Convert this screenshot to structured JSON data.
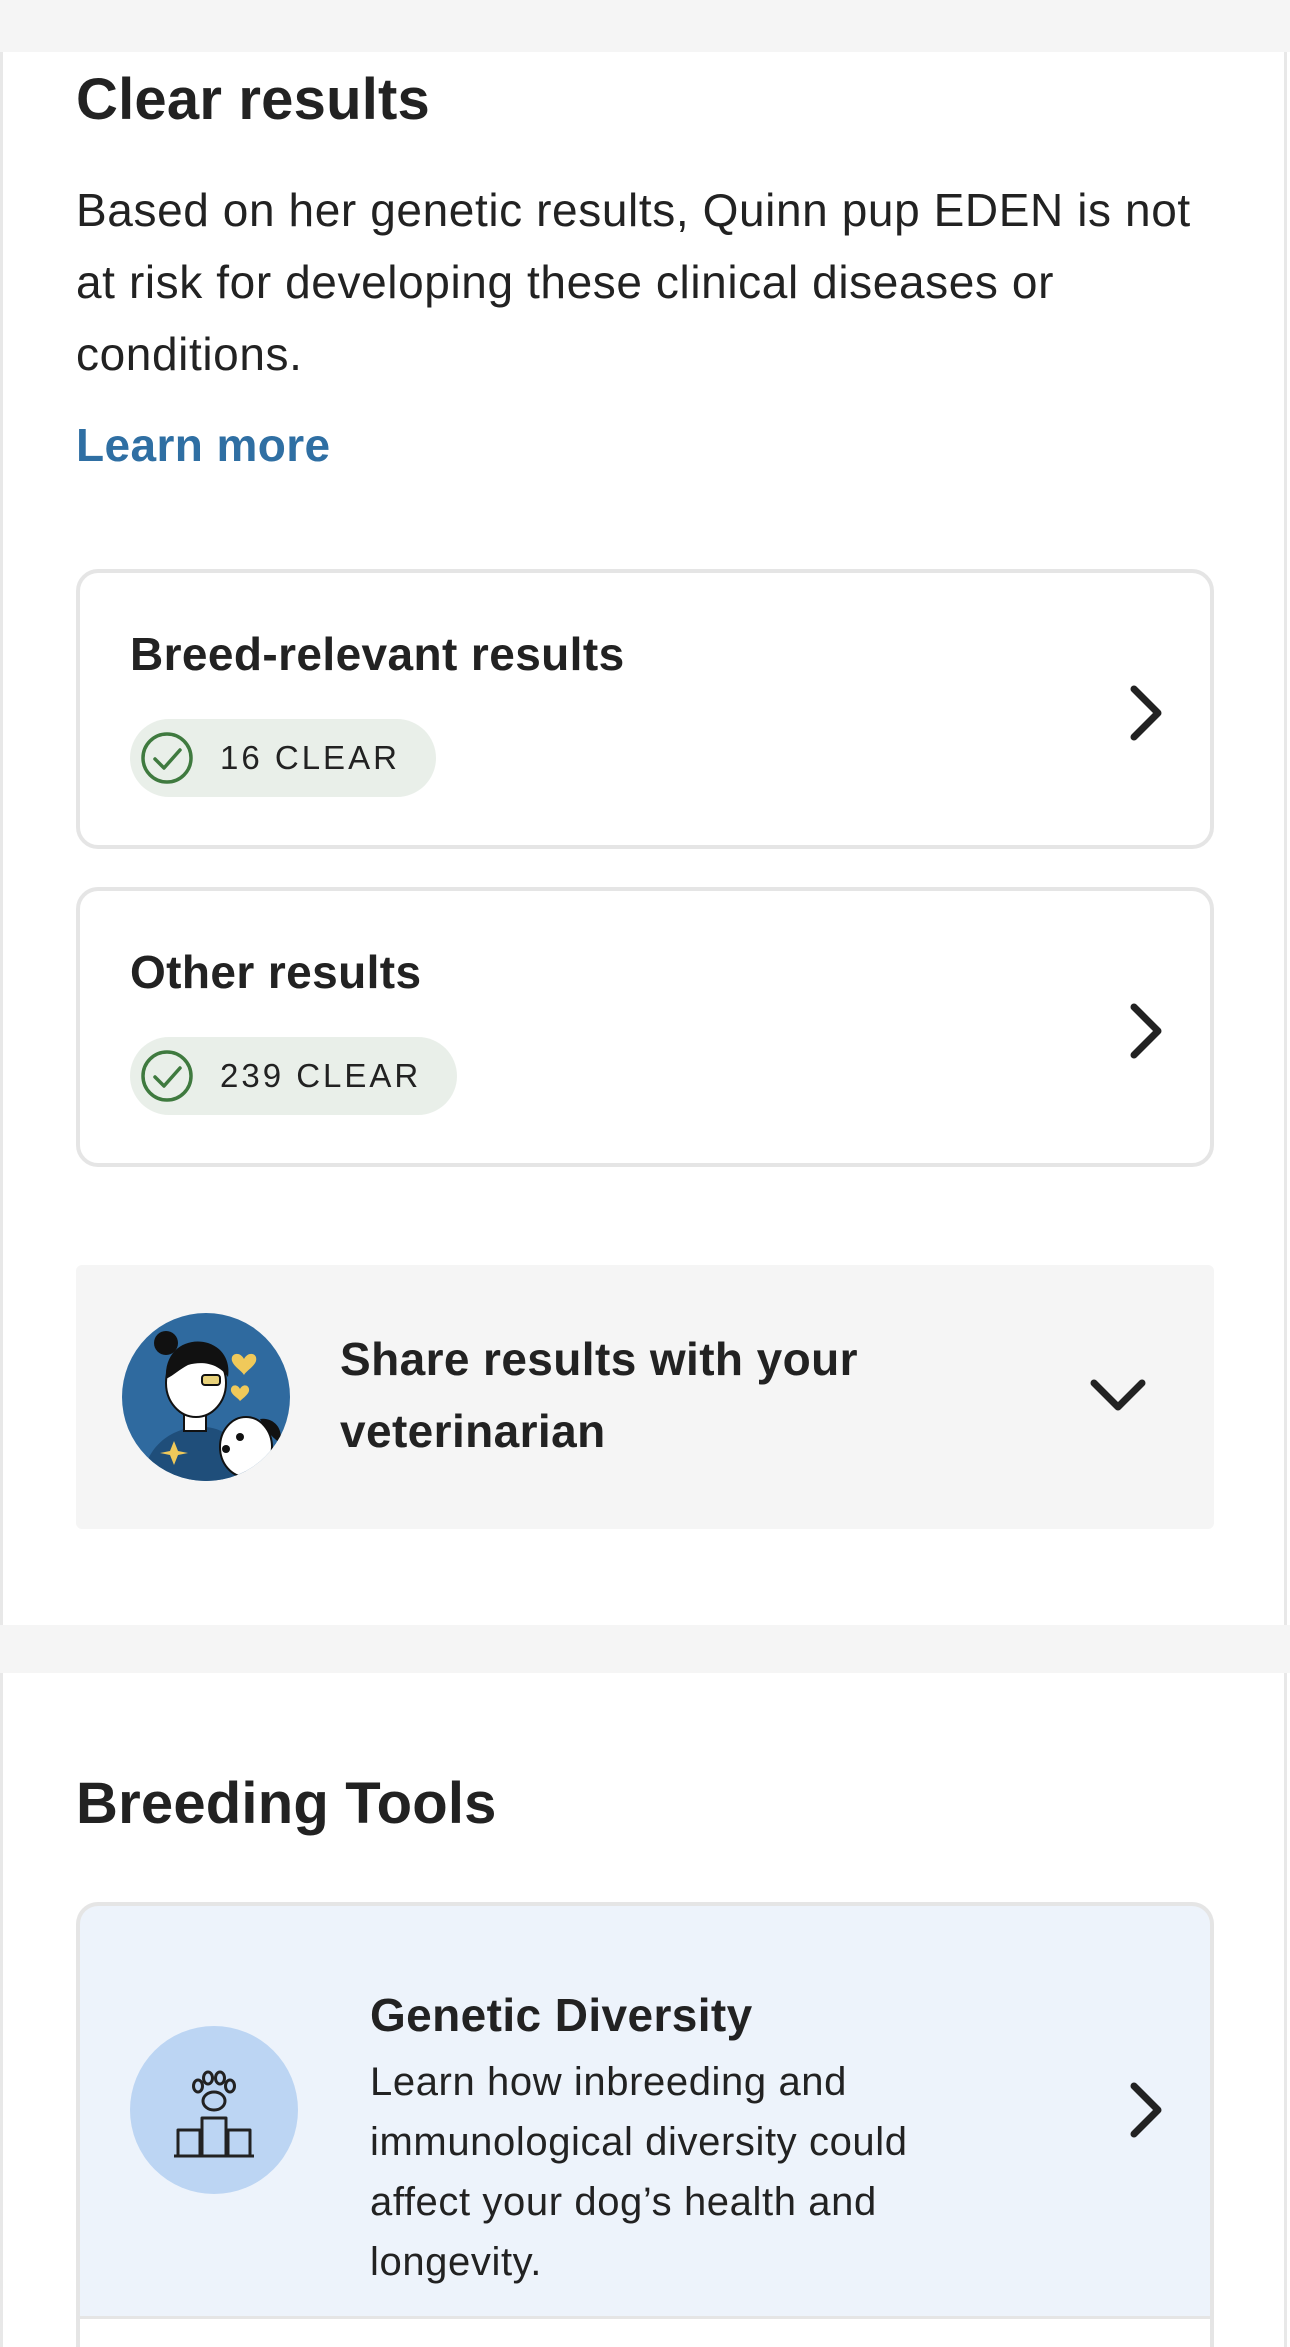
{
  "clear_section": {
    "title": "Clear results",
    "description": "Based on her genetic results, Quinn pup EDEN is not at risk for developing these clinical diseases or conditions.",
    "learn_more": "Learn more"
  },
  "result_cards": [
    {
      "title": "Breed-relevant results",
      "badge": "16 CLEAR",
      "icons": [
        "check-circle-icon",
        "chevron-right-icon"
      ]
    },
    {
      "title": "Other results",
      "badge": "239 CLEAR",
      "icons": [
        "check-circle-icon",
        "chevron-right-icon"
      ]
    }
  ],
  "share": {
    "label": "Share results with your veterinarian",
    "icons": [
      "veterinarian-avatar",
      "chevron-down-icon"
    ]
  },
  "breeding_tools": {
    "title": "Breeding Tools",
    "cards": [
      {
        "title": "Genetic Diversity",
        "description": "Learn how inbreeding and immunological diversity could affect your dog’s health and longevity.",
        "icons": [
          "paw-podium-icon",
          "chevron-right-icon"
        ]
      }
    ]
  },
  "colors": {
    "link": "#2f6fa3",
    "clear_badge_bg": "#e9efe9",
    "clear_check": "#3f7a3f",
    "share_bg": "#f5f5f5",
    "tool_card_bg": "#edf3fb",
    "tool_icon_bg": "#bcd5f3",
    "avatar_bg": "#2f6a9f"
  }
}
